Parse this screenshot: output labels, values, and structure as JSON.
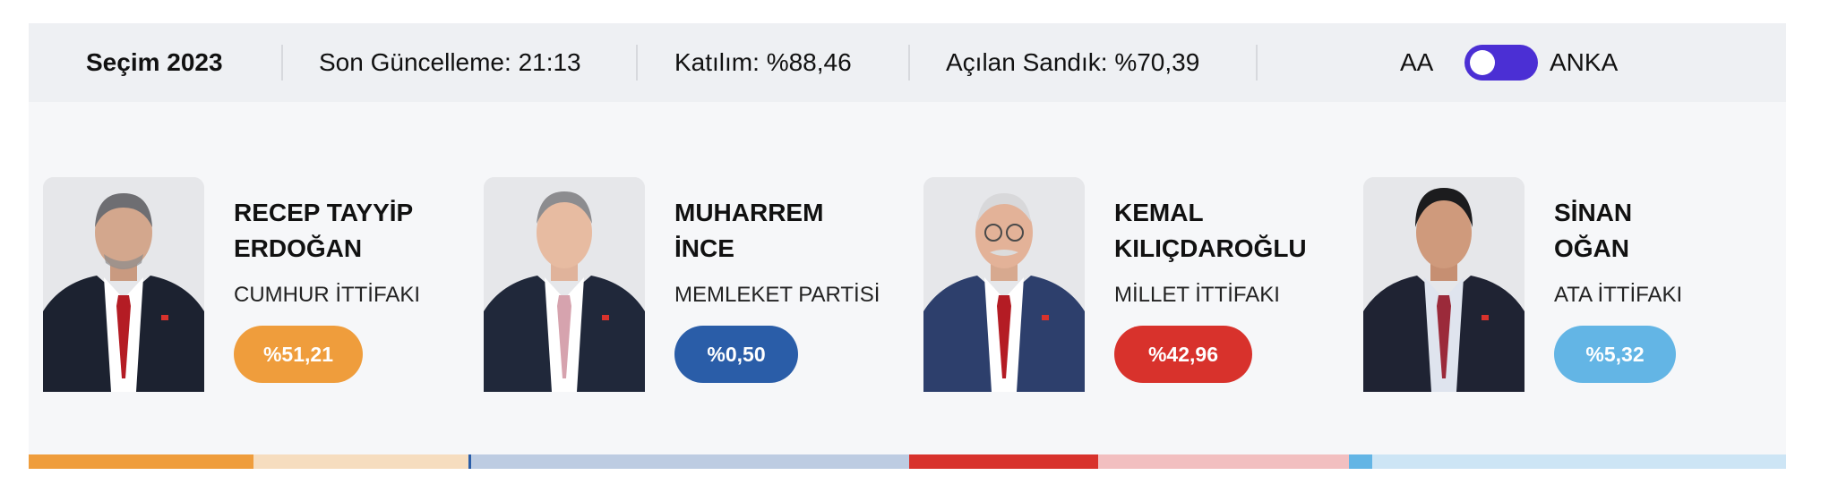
{
  "header": {
    "title": "Seçim 2023",
    "last_update": "Son Güncelleme: 21:13",
    "turnout": "Katılım: %88,46",
    "opened_ballots": "Açılan Sandık: %70,39",
    "source_left": "AA",
    "source_right": "ANKA",
    "source_toggle": "on"
  },
  "candidates": [
    {
      "name_line1": "RECEP TAYYİP",
      "name_line2": "ERDOĞAN",
      "party": "CUMHUR İTTİFAKI",
      "share_label": "%51,21",
      "share": 51.21,
      "color": "#ef9d3c"
    },
    {
      "name_line1": "MUHARREM",
      "name_line2": "İNCE",
      "party": "MEMLEKET PARTİSİ",
      "share_label": "%0,50",
      "share": 0.5,
      "color": "#2a5da8"
    },
    {
      "name_line1": "KEMAL",
      "name_line2": "KILIÇDAROĞLU",
      "party": "MİLLET İTTİFAKI",
      "share_label": "%42,96",
      "share": 42.96,
      "color": "#d8322c"
    },
    {
      "name_line1": "SİNAN",
      "name_line2": "OĞAN",
      "party": "ATA İTTİFAKI",
      "share_label": "%5,32",
      "share": 5.32,
      "color": "#63b5e5"
    }
  ],
  "icons": [
    "candidate-photo-erdogan",
    "candidate-photo-ince",
    "candidate-photo-kilicdaroglu",
    "candidate-photo-ogan",
    "source-toggle"
  ]
}
